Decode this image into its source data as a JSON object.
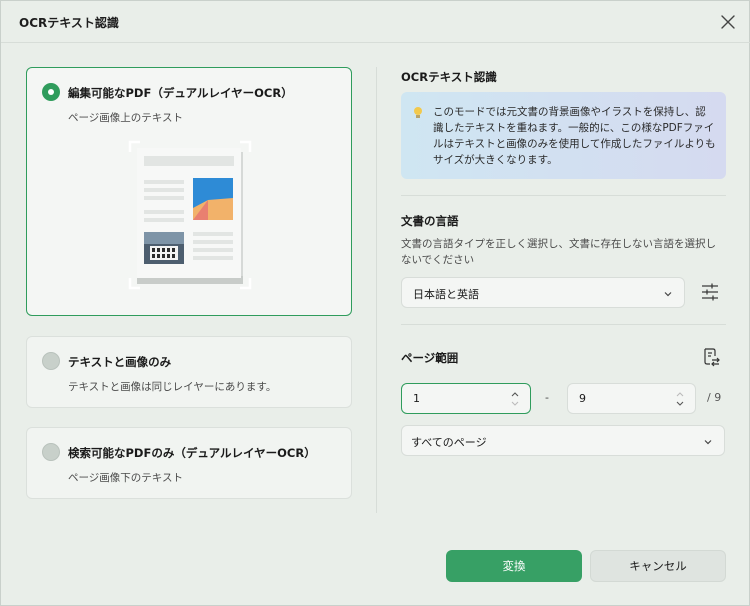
{
  "dialog": {
    "title": "OCRテキスト認識"
  },
  "options": [
    {
      "title": "編集可能なPDF（デュアルレイヤーOCR）",
      "desc": "ページ画像上のテキスト",
      "selected": true
    },
    {
      "title": "テキストと画像のみ",
      "desc": "テキストと画像は同じレイヤーにあります。",
      "selected": false
    },
    {
      "title": "検索可能なPDFのみ（デュアルレイヤーOCR）",
      "desc": "ページ画像下のテキスト",
      "selected": false
    }
  ],
  "ocr": {
    "heading": "OCRテキスト認識",
    "info": "このモードでは元文書の背景画像やイラストを保持し、認識したテキストを重ねます。一般的に、この様なPDFファイルはテキストと画像のみを使用して作成したファイルよりもサイズが大きくなります。"
  },
  "language": {
    "heading": "文書の言語",
    "desc": "文書の言語タイプを正しく選択し、文書に存在しない言語を選択しないでください",
    "selected": "日本語と英語"
  },
  "page_range": {
    "heading": "ページ範囲",
    "from": "1",
    "dash": "-",
    "to": "9",
    "total": "/ 9",
    "preset": "すべてのページ"
  },
  "buttons": {
    "convert": "変換",
    "cancel": "キャンセル"
  },
  "colors": {
    "accent": "#2f9c5c",
    "primary_button": "#37a065"
  }
}
